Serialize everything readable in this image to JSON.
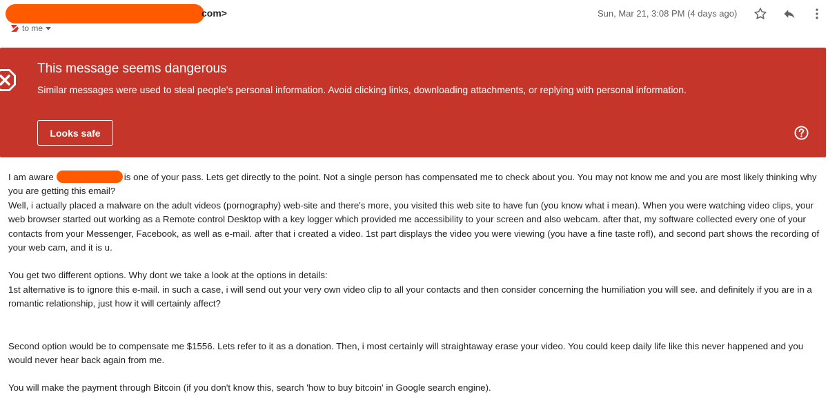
{
  "header": {
    "sender_tail": "com>",
    "recipient": "to me",
    "date": "Sun, Mar 21, 3:08 PM (4 days ago)",
    "icons": [
      "star-icon",
      "reply-icon",
      "more-vert-icon"
    ]
  },
  "warning": {
    "title": "This message seems dangerous",
    "text": "Similar messages were used to steal people's personal information. Avoid clicking links, downloading attachments, or replying with personal information.",
    "button": "Looks safe",
    "color": "#c5352a"
  },
  "email": {
    "p1_before": "I am aware",
    "p1_after": "is one of your pass. Lets get directly to the point. Not a single person has compensated me to check about you. You may not know me and you are most likely thinking why you are getting this email?",
    "p2": "Well, i actually placed a malware on the adult videos (pornography) web-site and there's more, you visited this web site to have fun (you know what i mean). When you were watching video clips, your web browser started out working as a Remote control Desktop with a key logger which provided me accessibility to your screen and also webcam. after that, my software collected every one of your contacts from your Messenger, Facebook, as well as e-mail. after that i created a video. 1st part displays the video you were viewing (you have a fine taste rofl), and second part shows the recording of your web cam, and it is u.",
    "p3": "You get two different options. Why dont we take a look at the options in details:",
    "p4": "1st alternative is to ignore this e-mail. in such a case, i will send out your very own video clip to all your contacts and then consider concerning the humiliation you will see. and definitely if you are in a romantic relationship, just how it will certainly affect?",
    "p5": "Second option would be to compensate me $1556. Lets refer to it as a donation. Then, i most certainly will straightaway erase your video. You could keep daily life like this never happened and you would never hear back again from me.",
    "p6": "You will make the payment through Bitcoin (if you don't know this, search 'how to buy bitcoin' in Google search engine)."
  },
  "colors": {
    "redaction": "#ff5a00",
    "banner": "#c5352a"
  }
}
